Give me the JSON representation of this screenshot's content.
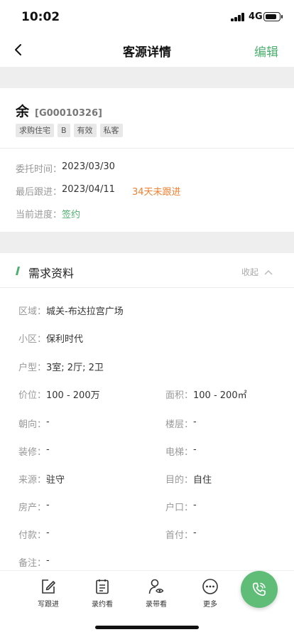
{
  "status": {
    "time": "10:02",
    "network": "4G",
    "battery_level": 0.85
  },
  "nav": {
    "title": "客源详情",
    "edit_label": "编辑"
  },
  "customer": {
    "name": "余",
    "code": "[G00010326]",
    "tags": [
      "求购住宅",
      "B",
      "有效",
      "私客"
    ]
  },
  "info": {
    "entrust_label": "委托时间：",
    "entrust_value": "2023/03/30",
    "last_follow_label": "最后跟进：",
    "last_follow_value": "2023/04/11",
    "follow_warning": "34天未跟进",
    "progress_label": "当前进度：",
    "progress_value": "签约"
  },
  "requirements": {
    "section_title": "需求资料",
    "collapse_label": "收起",
    "accent_color": "#4caf6e",
    "district": {
      "label": "区域：",
      "value": "城关-布达拉宫广场"
    },
    "community": {
      "label": "小区：",
      "value": "保利时代"
    },
    "layout": {
      "label": "户型：",
      "value": "3室; 2厅; 2卫"
    },
    "price": {
      "label": "价位：",
      "value": "100 - 200万"
    },
    "area": {
      "label": "面积：",
      "value": "100 - 200㎡"
    },
    "orientation": {
      "label": "朝向：",
      "value": "-"
    },
    "floor": {
      "label": "楼层：",
      "value": "-"
    },
    "decoration": {
      "label": "装修：",
      "value": "-"
    },
    "elevator": {
      "label": "电梯：",
      "value": "-"
    },
    "source": {
      "label": "来源：",
      "value": "驻守"
    },
    "purpose": {
      "label": "目的：",
      "value": "自住"
    },
    "property": {
      "label": "房产：",
      "value": "-"
    },
    "hukou": {
      "label": "户口：",
      "value": "-"
    },
    "payment": {
      "label": "付款：",
      "value": "-"
    },
    "down_payment": {
      "label": "首付：",
      "value": "-"
    },
    "remark": {
      "label": "备注：",
      "value": "-"
    }
  },
  "bottom_bar": {
    "tabs": [
      {
        "label": "写跟进",
        "icon": "edit-note-icon"
      },
      {
        "label": "录约看",
        "icon": "clipboard-icon"
      },
      {
        "label": "录带看",
        "icon": "user-eye-icon"
      },
      {
        "label": "更多",
        "icon": "more-dots-icon"
      }
    ],
    "call_icon": "phone-call-icon"
  }
}
